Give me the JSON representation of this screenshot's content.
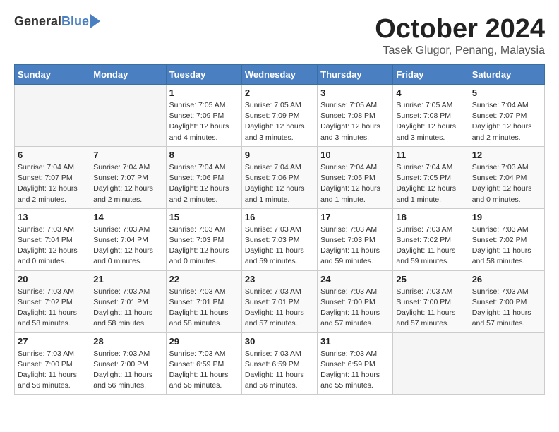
{
  "logo": {
    "general": "General",
    "blue": "Blue"
  },
  "title": "October 2024",
  "location": "Tasek Glugor, Penang, Malaysia",
  "headers": [
    "Sunday",
    "Monday",
    "Tuesday",
    "Wednesday",
    "Thursday",
    "Friday",
    "Saturday"
  ],
  "weeks": [
    [
      {
        "day": "",
        "info": ""
      },
      {
        "day": "",
        "info": ""
      },
      {
        "day": "1",
        "info": "Sunrise: 7:05 AM\nSunset: 7:09 PM\nDaylight: 12 hours and 4 minutes."
      },
      {
        "day": "2",
        "info": "Sunrise: 7:05 AM\nSunset: 7:09 PM\nDaylight: 12 hours and 3 minutes."
      },
      {
        "day": "3",
        "info": "Sunrise: 7:05 AM\nSunset: 7:08 PM\nDaylight: 12 hours and 3 minutes."
      },
      {
        "day": "4",
        "info": "Sunrise: 7:05 AM\nSunset: 7:08 PM\nDaylight: 12 hours and 3 minutes."
      },
      {
        "day": "5",
        "info": "Sunrise: 7:04 AM\nSunset: 7:07 PM\nDaylight: 12 hours and 2 minutes."
      }
    ],
    [
      {
        "day": "6",
        "info": "Sunrise: 7:04 AM\nSunset: 7:07 PM\nDaylight: 12 hours and 2 minutes."
      },
      {
        "day": "7",
        "info": "Sunrise: 7:04 AM\nSunset: 7:07 PM\nDaylight: 12 hours and 2 minutes."
      },
      {
        "day": "8",
        "info": "Sunrise: 7:04 AM\nSunset: 7:06 PM\nDaylight: 12 hours and 2 minutes."
      },
      {
        "day": "9",
        "info": "Sunrise: 7:04 AM\nSunset: 7:06 PM\nDaylight: 12 hours and 1 minute."
      },
      {
        "day": "10",
        "info": "Sunrise: 7:04 AM\nSunset: 7:05 PM\nDaylight: 12 hours and 1 minute."
      },
      {
        "day": "11",
        "info": "Sunrise: 7:04 AM\nSunset: 7:05 PM\nDaylight: 12 hours and 1 minute."
      },
      {
        "day": "12",
        "info": "Sunrise: 7:03 AM\nSunset: 7:04 PM\nDaylight: 12 hours and 0 minutes."
      }
    ],
    [
      {
        "day": "13",
        "info": "Sunrise: 7:03 AM\nSunset: 7:04 PM\nDaylight: 12 hours and 0 minutes."
      },
      {
        "day": "14",
        "info": "Sunrise: 7:03 AM\nSunset: 7:04 PM\nDaylight: 12 hours and 0 minutes."
      },
      {
        "day": "15",
        "info": "Sunrise: 7:03 AM\nSunset: 7:03 PM\nDaylight: 12 hours and 0 minutes."
      },
      {
        "day": "16",
        "info": "Sunrise: 7:03 AM\nSunset: 7:03 PM\nDaylight: 11 hours and 59 minutes."
      },
      {
        "day": "17",
        "info": "Sunrise: 7:03 AM\nSunset: 7:03 PM\nDaylight: 11 hours and 59 minutes."
      },
      {
        "day": "18",
        "info": "Sunrise: 7:03 AM\nSunset: 7:02 PM\nDaylight: 11 hours and 59 minutes."
      },
      {
        "day": "19",
        "info": "Sunrise: 7:03 AM\nSunset: 7:02 PM\nDaylight: 11 hours and 58 minutes."
      }
    ],
    [
      {
        "day": "20",
        "info": "Sunrise: 7:03 AM\nSunset: 7:02 PM\nDaylight: 11 hours and 58 minutes."
      },
      {
        "day": "21",
        "info": "Sunrise: 7:03 AM\nSunset: 7:01 PM\nDaylight: 11 hours and 58 minutes."
      },
      {
        "day": "22",
        "info": "Sunrise: 7:03 AM\nSunset: 7:01 PM\nDaylight: 11 hours and 58 minutes."
      },
      {
        "day": "23",
        "info": "Sunrise: 7:03 AM\nSunset: 7:01 PM\nDaylight: 11 hours and 57 minutes."
      },
      {
        "day": "24",
        "info": "Sunrise: 7:03 AM\nSunset: 7:00 PM\nDaylight: 11 hours and 57 minutes."
      },
      {
        "day": "25",
        "info": "Sunrise: 7:03 AM\nSunset: 7:00 PM\nDaylight: 11 hours and 57 minutes."
      },
      {
        "day": "26",
        "info": "Sunrise: 7:03 AM\nSunset: 7:00 PM\nDaylight: 11 hours and 57 minutes."
      }
    ],
    [
      {
        "day": "27",
        "info": "Sunrise: 7:03 AM\nSunset: 7:00 PM\nDaylight: 11 hours and 56 minutes."
      },
      {
        "day": "28",
        "info": "Sunrise: 7:03 AM\nSunset: 7:00 PM\nDaylight: 11 hours and 56 minutes."
      },
      {
        "day": "29",
        "info": "Sunrise: 7:03 AM\nSunset: 6:59 PM\nDaylight: 11 hours and 56 minutes."
      },
      {
        "day": "30",
        "info": "Sunrise: 7:03 AM\nSunset: 6:59 PM\nDaylight: 11 hours and 56 minutes."
      },
      {
        "day": "31",
        "info": "Sunrise: 7:03 AM\nSunset: 6:59 PM\nDaylight: 11 hours and 55 minutes."
      },
      {
        "day": "",
        "info": ""
      },
      {
        "day": "",
        "info": ""
      }
    ]
  ]
}
